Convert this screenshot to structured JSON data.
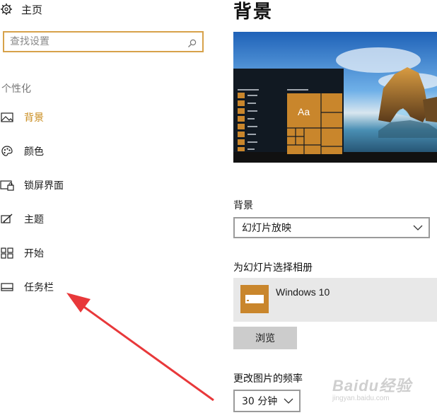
{
  "nav": {
    "home_label": "主页",
    "search_placeholder": "查找设置",
    "section_label": "个性化",
    "items": [
      {
        "label": "背景",
        "icon": "image-icon",
        "active": true
      },
      {
        "label": "颜色",
        "icon": "palette-icon",
        "active": false
      },
      {
        "label": "锁屏界面",
        "icon": "lock-screen-icon",
        "active": false
      },
      {
        "label": "主题",
        "icon": "brush-icon",
        "active": false
      },
      {
        "label": "开始",
        "icon": "start-grid-icon",
        "active": false
      },
      {
        "label": "任务栏",
        "icon": "taskbar-icon",
        "active": false
      }
    ]
  },
  "main": {
    "title": "背景",
    "preview_tile_text": "Aa",
    "background_label": "背景",
    "background_value": "幻灯片放映",
    "album_label": "为幻灯片选择相册",
    "album_name": "Windows 10",
    "browse_label": "浏览",
    "frequency_label": "更改图片的频率",
    "frequency_value": "30 分钟"
  },
  "watermark": {
    "brand": "Baidu经验",
    "url": "jingyan.baidu.com"
  },
  "colors": {
    "accent": "#c88a1a",
    "search_border": "#d7a24a",
    "tile": "#c9862c",
    "arrow": "#e8383a"
  }
}
